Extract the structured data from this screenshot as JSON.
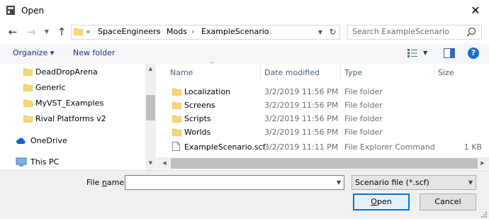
{
  "window": {
    "title": "Open"
  },
  "address": {
    "overflow": "«",
    "crumbs": [
      "SpaceEngineers",
      "Mods",
      "ExampleScenario"
    ],
    "separator": "›"
  },
  "search": {
    "placeholder": "Search ExampleScenario"
  },
  "toolbar": {
    "organize": "Organize ▾",
    "new_folder": "New folder",
    "help": "?"
  },
  "nav": {
    "items": [
      {
        "label": "DeadDropArena"
      },
      {
        "label": "Generic"
      },
      {
        "label": "MyVST_Examples"
      },
      {
        "label": "Rival Platforms v2"
      },
      {
        "label": "OneDrive"
      },
      {
        "label": "This PC"
      }
    ]
  },
  "columns": {
    "name": "Name",
    "date": "Date modified",
    "type": "Type",
    "size": "Size"
  },
  "files": [
    {
      "name": "Localization",
      "date": "3/2/2019 11:56 PM",
      "type": "File folder",
      "size": ""
    },
    {
      "name": "Screens",
      "date": "3/2/2019 11:56 PM",
      "type": "File folder",
      "size": ""
    },
    {
      "name": "Scripts",
      "date": "3/2/2019 11:56 PM",
      "type": "File folder",
      "size": ""
    },
    {
      "name": "Worlds",
      "date": "3/2/2019 11:56 PM",
      "type": "File folder",
      "size": ""
    },
    {
      "name": "ExampleScenario.scf",
      "date": "3/2/2019 11:11 PM",
      "type": "File Explorer Command",
      "size": "1 KB"
    }
  ],
  "bottom": {
    "filename_label_pre": "File ",
    "filename_label_u": "n",
    "filename_label_post": "ame:",
    "filename_value": "",
    "filetype": "Scenario file (*.scf)",
    "open_u": "O",
    "open_rest": "pen",
    "cancel": "Cancel"
  },
  "colors": {
    "folder": "#f8d775",
    "accent": "#0078d7",
    "link": "#1e3287"
  }
}
